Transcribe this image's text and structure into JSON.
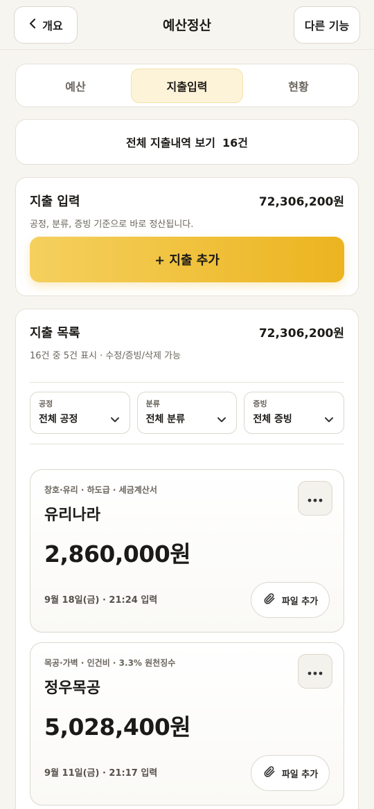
{
  "header": {
    "back_label": "개요",
    "title": "예산정산",
    "more_label": "다른 기능"
  },
  "tabs": [
    {
      "label": "예산",
      "active": false
    },
    {
      "label": "지출입력",
      "active": true
    },
    {
      "label": "현황",
      "active": false
    }
  ],
  "view_all": {
    "label": "전체 지출내역 보기",
    "count": "16건"
  },
  "entry_section": {
    "title": "지출 입력",
    "amount": "72,306,200원",
    "subtitle": "공정, 분류, 증빙 기준으로 바로 정산됩니다.",
    "add_button": "+ 지출 추가"
  },
  "list_section": {
    "title": "지출 목록",
    "amount": "72,306,200원",
    "subtitle": "16건 중 5건 표시 · 수정/증빙/삭제 가능"
  },
  "filters": [
    {
      "label": "공정",
      "value": "전체 공정"
    },
    {
      "label": "분류",
      "value": "전체 분류"
    },
    {
      "label": "증빙",
      "value": "전체 증빙"
    }
  ],
  "expenses": [
    {
      "meta": "창호·유리 · 하도급 · 세금계산서",
      "vendor": "유리나라",
      "amount": "2,860,000원",
      "date": "9월 18일(금) · 21:24 입력",
      "file_label": "파일 추가"
    },
    {
      "meta": "목공·가벽 · 인건비 · 3.3% 원천징수",
      "vendor": "정우목공",
      "amount": "5,028,400원",
      "date": "9월 11일(금) · 21:17 입력",
      "file_label": "파일 추가"
    }
  ],
  "colors": {
    "accent_start": "#f5d05e",
    "accent_end": "#ecb41f",
    "active_tab_bg": "#fdf3d8",
    "background": "#f7f5f0"
  }
}
